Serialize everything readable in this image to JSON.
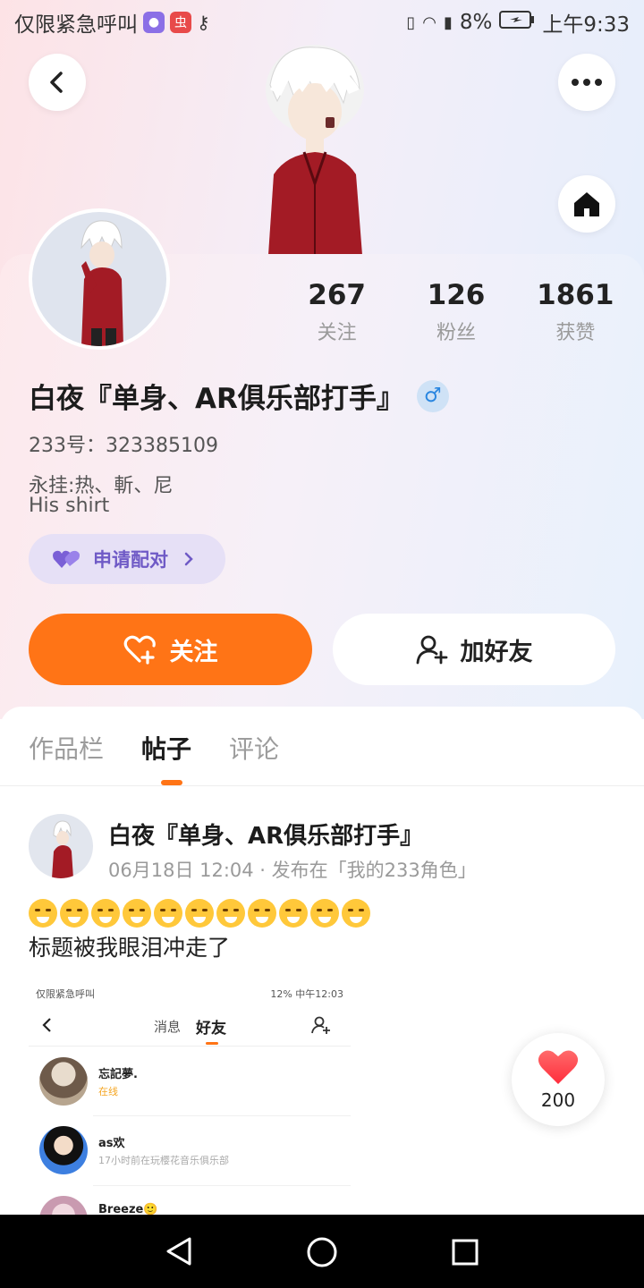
{
  "status_bar": {
    "carrier": "仅限紧急呼叫",
    "battery": "8%",
    "time": "上午9:33"
  },
  "profile": {
    "stats": [
      {
        "value": "267",
        "label": "关注"
      },
      {
        "value": "126",
        "label": "粉丝"
      },
      {
        "value": "1861",
        "label": "获赞"
      }
    ],
    "name": "白夜『单身、AR俱乐部打手』",
    "gender_symbol": "♂",
    "uid": "233号：323385109",
    "bio_line1": "永挂:热、斬、尼",
    "bio_line2": "His shirt",
    "pair_label": "申请配对",
    "follow_label": "关注",
    "add_friend_label": "加好友"
  },
  "tabs": [
    {
      "label": "作品栏",
      "active": false
    },
    {
      "label": "帖子",
      "active": true
    },
    {
      "label": "评论",
      "active": false
    }
  ],
  "post": {
    "author": "白夜『单身、AR俱乐部打手』",
    "meta": "06月18日 12:04 · 发布在「我的233角色」",
    "emoji_count": 11,
    "title": "标题被我眼泪冲走了",
    "screenshot": {
      "status_left": "仅限紧急呼叫",
      "status_right": "12%  中午12:03",
      "tab_messages": "消息",
      "tab_friends": "好友",
      "rows": [
        {
          "name": "忘記夢.",
          "sub": "在线"
        },
        {
          "name": "as欢",
          "sub": "17小时前在玩樱花音乐俱乐部"
        },
        {
          "name": "Breeze🙂",
          "sub": ""
        }
      ]
    }
  },
  "like_count": "200",
  "colors": {
    "accent": "#ff7416",
    "pair": "#6f5ac6",
    "gender": "#2a86e0"
  },
  "icons": [
    "back-icon",
    "more-icon",
    "home-icon",
    "heart-plus-icon",
    "add-user-icon",
    "heart-icon",
    "chevron-right-icon",
    "triangle-back-icon",
    "circle-home-icon",
    "square-recents-icon"
  ]
}
